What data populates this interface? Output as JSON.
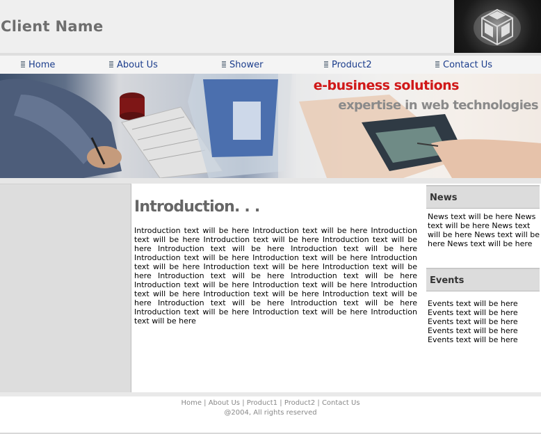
{
  "header": {
    "client_name": "Client Name"
  },
  "nav": {
    "items": [
      {
        "label": "Home"
      },
      {
        "label": "About Us"
      },
      {
        "label": "Shower"
      },
      {
        "label": "Product2"
      },
      {
        "label": "Contact Us"
      }
    ]
  },
  "banner": {
    "title": "e-business solutions",
    "subtitle": "expertise in web technologies"
  },
  "main": {
    "title": "Introduction. . .",
    "text": "Introduction text will be here Introduction text will be here Introduction text will be here Introduction text will be here Introduction text will be here Introduction text will be here Introduction text will be here Introduction text will be here Introduction text will be here Introduction text will be here Introduction text will be here Introduction text will be here Introduction text will be here Introduction text will be here Introduction text will be here Introduction text will be here Introduction text will be here Introduction text will be here Introduction text will be here Introduction text will be here Introduction text will be here Introduction text will be here Introduction text will be here Introduction text will be here"
  },
  "sidebar": {
    "news_heading": "News",
    "news_text": "News text will be here News text will be here News text will be here News text will be here News text will be here",
    "events_heading": "Events",
    "events_lines": [
      "Events text will be here",
      "Events text will be here",
      "Events text will be here",
      "Events text will be here",
      "Events text will be here"
    ]
  },
  "footer": {
    "links": [
      "Home",
      "About Us",
      "Product1",
      "Product2",
      "Contact Us"
    ],
    "separator": "|",
    "copyright": "@2004, All rights reserved"
  },
  "colors": {
    "nav_link": "#1a3c8c",
    "banner_title": "#d01818",
    "banner_subtitle": "#8a8a8a",
    "header_bg": "#efefef"
  }
}
